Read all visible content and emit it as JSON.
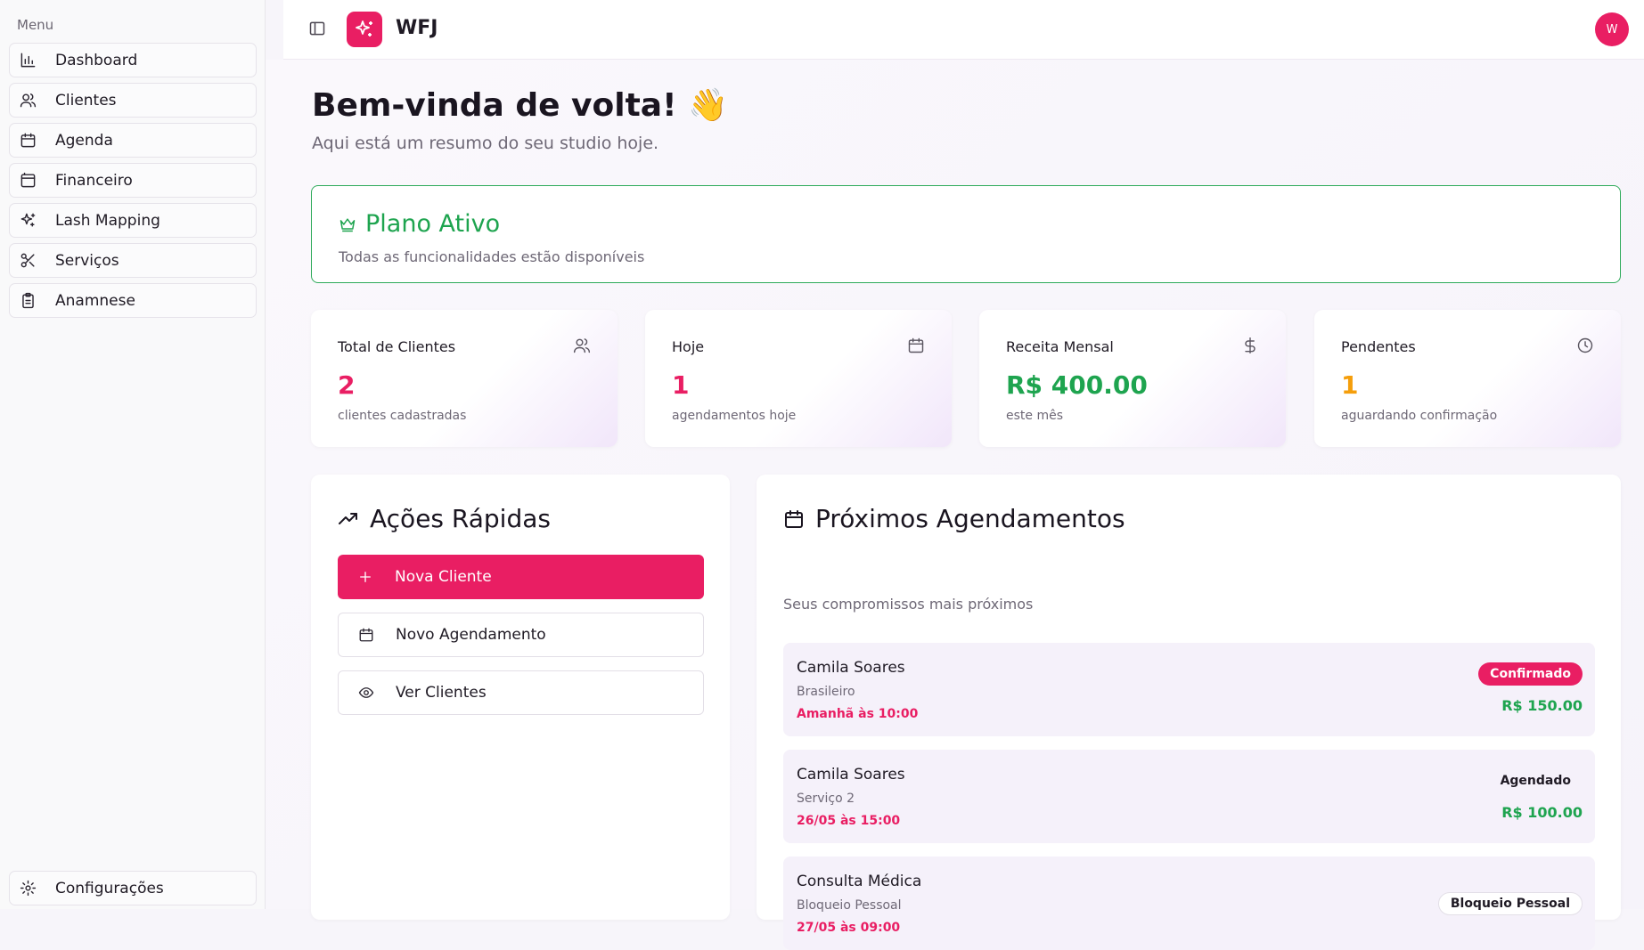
{
  "sidebar": {
    "menu_label": "Menu",
    "items": [
      {
        "label": "Dashboard",
        "icon": "bar-chart-icon"
      },
      {
        "label": "Clientes",
        "icon": "users-icon"
      },
      {
        "label": "Agenda",
        "icon": "calendar-icon"
      },
      {
        "label": "Financeiro",
        "icon": "wallet-icon"
      },
      {
        "label": "Lash Mapping",
        "icon": "sparkles-icon"
      },
      {
        "label": "Serviços",
        "icon": "scissors-icon"
      },
      {
        "label": "Anamnese",
        "icon": "clipboard-icon"
      }
    ],
    "settings_label": "Configurações"
  },
  "header": {
    "brand": "WFJ",
    "avatar_initial": "W"
  },
  "main": {
    "title": "Bem-vinda de volta! 👋",
    "subtitle": "Aqui está um resumo do seu studio hoje."
  },
  "plan": {
    "title": "Plano Ativo",
    "subtitle": "Todas as funcionalidades estão disponíveis"
  },
  "stats": [
    {
      "label": "Total de Clientes",
      "value": "2",
      "caption": "clientes cadastradas",
      "color": "#e91e63",
      "icon": "users-icon"
    },
    {
      "label": "Hoje",
      "value": "1",
      "caption": "agendamentos hoje",
      "color": "#e91e63",
      "icon": "calendar-icon"
    },
    {
      "label": "Receita Mensal",
      "value": "R$ 400.00",
      "caption": "este mês",
      "color": "#1ea44f",
      "icon": "dollar-icon"
    },
    {
      "label": "Pendentes",
      "value": "1",
      "caption": "aguardando confirmação",
      "color": "#f59e0b",
      "icon": "clock-icon"
    }
  ],
  "actions": {
    "title": "Ações Rápidas",
    "new_client": "Nova Cliente",
    "new_appointment": "Novo Agendamento",
    "view_clients": "Ver Clientes"
  },
  "appointments": {
    "title": "Próximos Agendamentos",
    "subtitle": "Seus compromissos mais próximos",
    "items": [
      {
        "name": "Camila Soares",
        "service": "Brasileiro",
        "time": "Amanhã às 10:00",
        "status": "Confirmado",
        "price": "R$ 150.00"
      },
      {
        "name": "Camila Soares",
        "service": "Serviço 2",
        "time": "26/05 às 15:00",
        "status": "Agendado",
        "price": "R$ 100.00"
      },
      {
        "name": "Consulta Médica",
        "service": "Bloqueio Pessoal",
        "time": "27/05 às 09:00",
        "status": "Bloqueio Pessoal",
        "price": ""
      }
    ]
  },
  "colors": {
    "brand": "#e91e63",
    "success": "#1ea44f",
    "warning": "#f59e0b"
  }
}
